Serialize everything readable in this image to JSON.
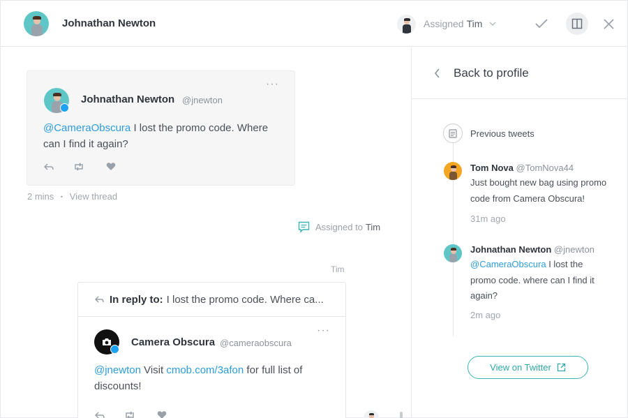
{
  "header": {
    "contact_name": "Johnathan Newton",
    "assigned_label": "Assigned",
    "assigned_name": "Tim"
  },
  "feed": {
    "tweet": {
      "name": "Johnathan Newton",
      "handle": "@jnewton",
      "mention": "@CameraObscura",
      "text": " I lost the promo code. Where can I find it again?",
      "more": "···"
    },
    "meta": {
      "time": "2 mins",
      "separator": "•",
      "view_thread": "View thread"
    },
    "system_event": {
      "label": "Assigned to",
      "name": "Tim"
    },
    "reply_author": "Tim",
    "reply": {
      "in_reply_label": "In reply to:",
      "in_reply_text": "I lost the promo code. Where ca...",
      "name": "Camera Obscura",
      "handle": "@cameraobscura",
      "mention": "@jnewton",
      "text_1": " Visit ",
      "link": "cmob.com/3afon",
      "text_2": " for full list of discounts!",
      "more": "···"
    }
  },
  "panel": {
    "back_label": "Back to profile",
    "previous_tweets_label": "Previous tweets",
    "timeline": [
      {
        "name": "Tom Nova",
        "handle": "@TomNova44",
        "text": "Just bought new bag using promo code from Camera Obscura!",
        "time": "31m ago"
      },
      {
        "name": "Johnathan Newton",
        "handle": "@jnewton",
        "mention": "@CameraObscura",
        "text": " I lost the promo code. where can I find it again?",
        "time": "2m ago"
      }
    ],
    "view_button": "View on Twitter"
  },
  "colors": {
    "accent": "#2ea7a8",
    "mention": "#2d9cdb",
    "twitter_badge": "#1da1f2"
  }
}
